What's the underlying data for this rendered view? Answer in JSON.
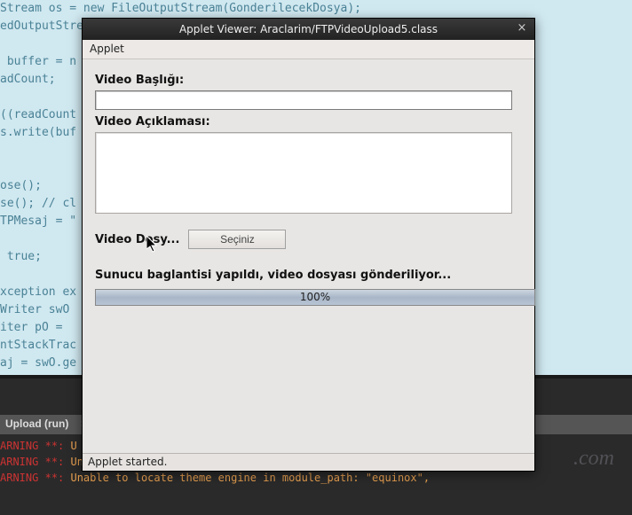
{
  "background": {
    "code_lines": "Stream os = new FileOutputStream(GonderilecekDosya);\nedOutputStream bus = new BufferedOutputStream(os);\n\n buffer = n\nadCount;\n\n((readCount\ns.write(buf\n\n\nose();\nse(); // cl\nTPMesaj = \"\n\n true;\n\nxception ex\nWriter swO \niter pO = \nntStackTrac\naj = swO.ge\n\n false;\n"
  },
  "console": {
    "header_label": "Upload (run)",
    "header_indicator": "×",
    "lines": [
      {
        "prefix": "ARNING **: ",
        "msg": "U"
      },
      {
        "prefix": "ARNING **: ",
        "msg": "Unable to locate theme engine in module_path: \"equinox\","
      },
      {
        "prefix": "ARNING **: ",
        "msg": "Unable to locate theme engine in module_path: \"equinox\","
      }
    ]
  },
  "watermark": ".com",
  "dialog": {
    "title": "Applet Viewer: Araclarim/FTPVideoUpload5.class",
    "menu": "Applet",
    "label_title": "Video Başlığı:",
    "input_value": "",
    "label_desc": "Video Açıklaması:",
    "textarea_value": "",
    "label_file": "Video Dosy...",
    "button_choose": "Seçiniz",
    "status_text": "Sunucu baglantisi yapıldı, video dosyası gönderiliyor...",
    "progress_percent": "100%",
    "statusbar": "Applet started."
  }
}
